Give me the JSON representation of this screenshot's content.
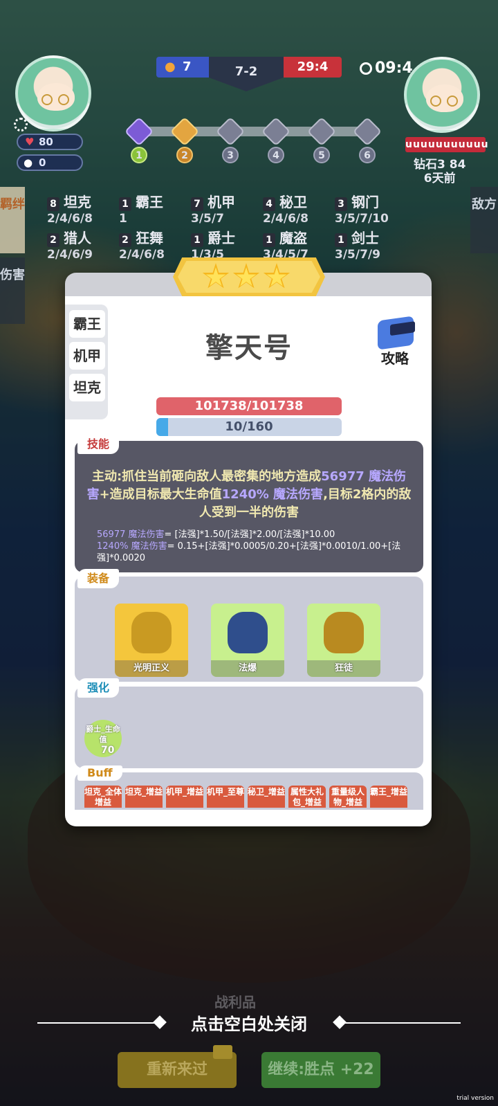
{
  "hud": {
    "hearts": "80",
    "coins": "0",
    "score_left": "7",
    "round": "7-2",
    "score_right": "29:4",
    "timer": "09:4",
    "stages": [
      "1",
      "2",
      "3",
      "4",
      "5",
      "6"
    ],
    "enemy_hp": "uuuuuuuuuuu",
    "enemy_meta_line1": "钻石3 84",
    "enemy_meta_line2": "6天前"
  },
  "side_tabs": {
    "left_top": "羁绊",
    "left_bottom": "伤害",
    "right": "敌方"
  },
  "traits": [
    {
      "count": "8",
      "name": "坦克",
      "levels": "2/4/6/8"
    },
    {
      "count": "1",
      "name": "霸王",
      "levels": "1"
    },
    {
      "count": "7",
      "name": "机甲",
      "levels": "3/5/7"
    },
    {
      "count": "4",
      "name": "秘卫",
      "levels": "2/4/6/8"
    },
    {
      "count": "3",
      "name": "钢门",
      "levels": "3/5/7/10"
    },
    {
      "count": "2",
      "name": "猎人",
      "levels": "2/4/6/9"
    },
    {
      "count": "2",
      "name": "狂舞",
      "levels": "2/4/6/8"
    },
    {
      "count": "1",
      "name": "爵士",
      "levels": "1/3/5"
    },
    {
      "count": "1",
      "name": "魔盗",
      "levels": "3/4/5/7"
    },
    {
      "count": "1",
      "name": "剑士",
      "levels": "3/5/7/9"
    }
  ],
  "modal": {
    "star_count": 3,
    "unit_traits": [
      "霸王",
      "机甲",
      "坦克"
    ],
    "unit_name": "擎天号",
    "guide_label": "攻略",
    "hp_text": "101738/101738",
    "mana_text": "10/160",
    "mana_fraction": 0.0625,
    "skill": {
      "tag": "技能",
      "main_a": "主动:抓住当前砸向敌人最密集的地方造成",
      "main_b": "56977 魔法伤害",
      "main_c": "+造成目标最大生命值",
      "main_d": "1240% 魔法伤害",
      "main_e": ",目标2格内的敌人受到一半的伤害",
      "formula1_a": "56977 魔法伤害",
      "formula1_b": "= [法强]*1.50/[法强]*2.00/[法强]*10.00",
      "formula2_a": "1240% 魔法伤害",
      "formula2_b": "= 0.15+[法强]*0.0005/0.20+[法强]*0.0010/1.00+[法强]*0.0020"
    },
    "equipment": {
      "tag": "装备",
      "items": [
        {
          "label": "光明正义",
          "bg": "#f4c63c",
          "art": "#c99a22"
        },
        {
          "label": "法爆",
          "bg": "#c8f08e",
          "art": "#2f4e8c"
        },
        {
          "label": "狂徒",
          "bg": "#c8f08e",
          "art": "#b98a20"
        }
      ]
    },
    "enhance": {
      "tag": "强化",
      "item_label": "爵士_生命值",
      "item_value": "70"
    },
    "buff": {
      "tag": "Buff",
      "tags": [
        "坦克_全体增益",
        "坦克_增益",
        "机甲_增益",
        "机甲_至尊",
        "秘卫_增益",
        "属性大礼包_增益",
        "重量级人物_增益",
        "霸王_增益"
      ]
    }
  },
  "bottom": {
    "loot_label": "战利品",
    "close_hint": "点击空白处关闭",
    "retry_label": "重新来过",
    "continue_label": "继续:胜点 +22"
  },
  "watermark": "trial version"
}
